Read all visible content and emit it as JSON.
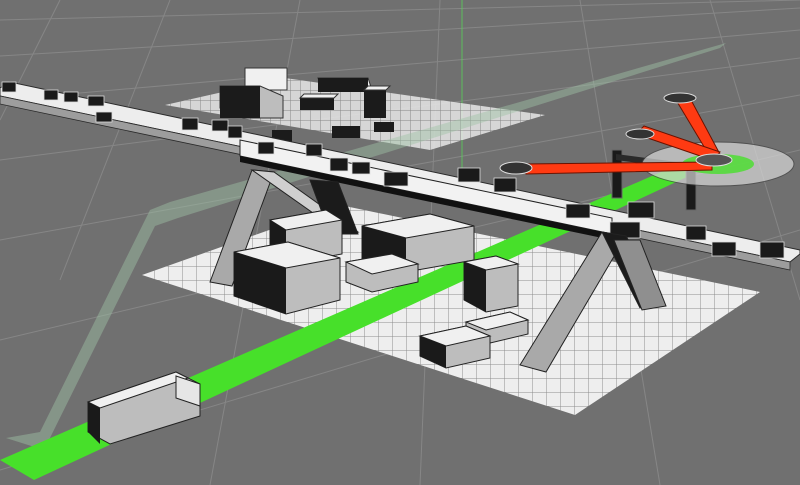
{
  "viewport": {
    "camera": "perspective",
    "background_color": "#707070",
    "grid_color": "#9a9a9a"
  },
  "colors": {
    "selected_path": "#47e02a",
    "rig_arms": "#ff3a12",
    "box_top": "#f2f2f2",
    "box_side": "#b9b9b9",
    "box_front": "#1a1a1a",
    "ground_tile": "#f0f0f0",
    "translucent_path": "#9fc4a6",
    "vertical_guide": "#58d258"
  },
  "scene_objects": {
    "ground_planes": 2,
    "bridge_beam": "bridge-beam",
    "support_legs": 2,
    "gate_posts": 2,
    "rotor_rig_arms": 3,
    "truck": "truck"
  }
}
